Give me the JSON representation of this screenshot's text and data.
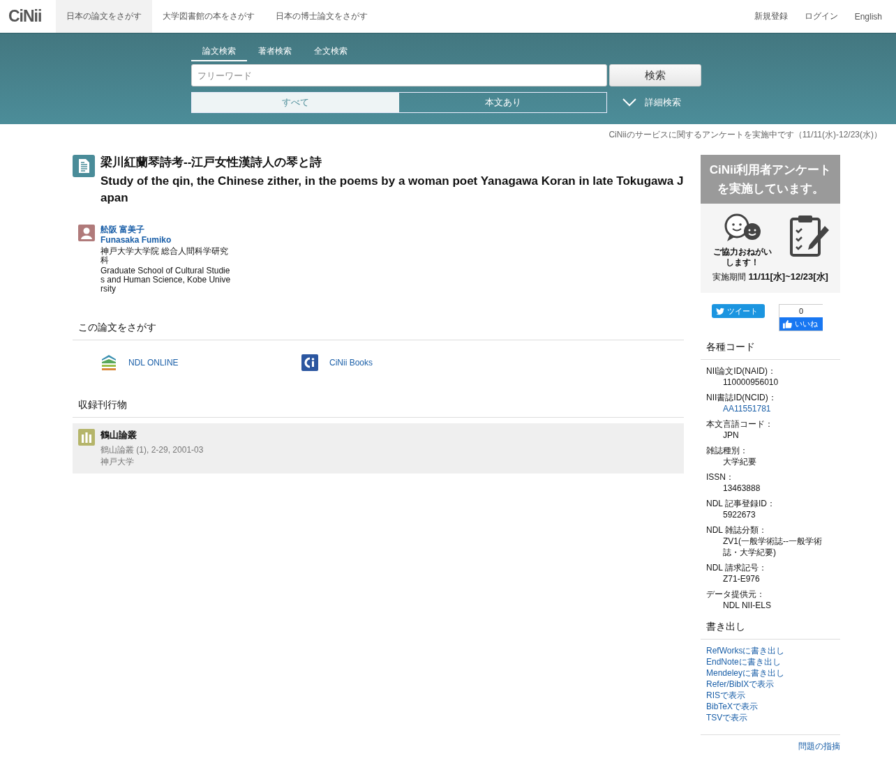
{
  "header": {
    "logo": "CiNii",
    "nav": [
      {
        "label": "日本の論文をさがす",
        "selected": true
      },
      {
        "label": "大学図書館の本をさがす",
        "selected": false
      },
      {
        "label": "日本の博士論文をさがす",
        "selected": false
      }
    ],
    "right_links": [
      "新規登録",
      "ログイン",
      "English"
    ]
  },
  "search": {
    "tabs": [
      {
        "label": "論文検索",
        "selected": true
      },
      {
        "label": "著者検索",
        "selected": false
      },
      {
        "label": "全文検索",
        "selected": false
      }
    ],
    "placeholder": "フリーワード",
    "button": "検索",
    "filters": [
      {
        "label": "すべて",
        "selected": true
      },
      {
        "label": "本文あり",
        "selected": false
      }
    ],
    "advanced": "詳細検索"
  },
  "notice": "CiNiiのサービスに関するアンケートを実施中です（11/11(水)-12/23(水)）",
  "article": {
    "title_ja": "梁川紅蘭琴詩考--江戸女性漢詩人の琴と詩",
    "title_en": "Study of the qin, the Chinese zither, in the poems by a woman poet Yanagawa Koran in late Tokugawa Japan",
    "authors": [
      {
        "name_ja": "舩阪 富美子",
        "name_en": "Funasaka Fumiko",
        "affiliation_ja": "神戸大学大学院 総合人間科学研究科",
        "affiliation_en": "Graduate School of Cultural Studies and Human Science, Kobe University"
      }
    ]
  },
  "find_section": {
    "heading": "この論文をさがす",
    "links": [
      {
        "kind": "ndl",
        "label": "NDL ONLINE"
      },
      {
        "kind": "cinii",
        "label": "CiNii Books"
      }
    ]
  },
  "journal_section": {
    "heading": "収録刊行物",
    "items": [
      {
        "title": "鶴山論叢",
        "citation": "鶴山論叢 (1), 2-29, 2001-03",
        "publisher": "神戸大学"
      }
    ]
  },
  "survey_banner": {
    "headline": "CiNii利用者アンケートを実施しています。",
    "caption": "ご協力おねがいします！",
    "period_label": "実施期間",
    "period": "11/11[水]~12/23[水]"
  },
  "social": {
    "tweet": "ツイート",
    "like_count": "0",
    "like": "いいね"
  },
  "codes": {
    "heading": "各種コード",
    "items": [
      {
        "label": "NII論文ID(NAID)：",
        "value": "110000956010",
        "kind": "text"
      },
      {
        "label": "NII書誌ID(NCID)：",
        "value": "AA11551781",
        "kind": "link"
      },
      {
        "label": "本文言語コード：",
        "value": "JPN",
        "kind": "text"
      },
      {
        "label": "雑誌種別：",
        "value": "大学紀要",
        "kind": "text"
      },
      {
        "label": "ISSN：",
        "value": "13463888",
        "kind": "text"
      },
      {
        "label": "NDL 記事登録ID：",
        "value": "5922673",
        "kind": "text"
      },
      {
        "label": "NDL 雑誌分類：",
        "value": "ZV1(一般学術誌--一般学術誌・大学紀要)",
        "kind": "text"
      },
      {
        "label": "NDL 請求記号：",
        "value": "Z71-E976",
        "kind": "text"
      },
      {
        "label": "データ提供元：",
        "value": "NDL  NII-ELS",
        "kind": "text"
      }
    ]
  },
  "export": {
    "heading": "書き出し",
    "links": [
      "RefWorksに書き出し",
      "EndNoteに書き出し",
      "Mendeleyに書き出し",
      "Refer/BibIXで表示",
      "RISで表示",
      "BibTeXで表示",
      "TSVで表示"
    ]
  },
  "report_link": "問題の指摘"
}
